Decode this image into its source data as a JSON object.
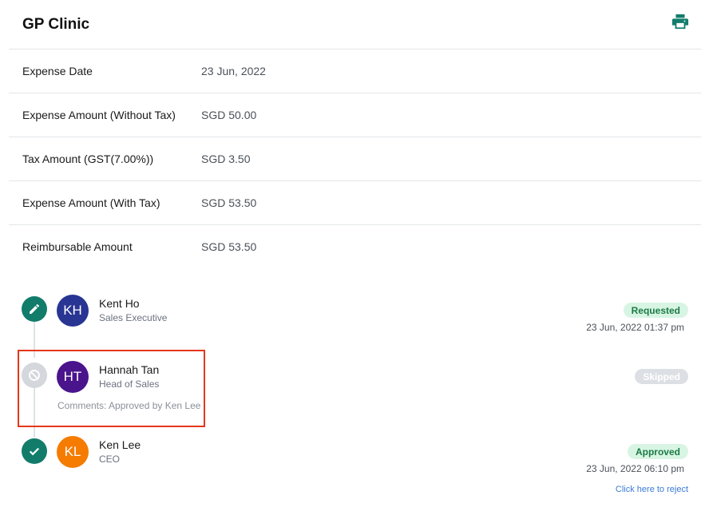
{
  "title": "GP Clinic",
  "print_icon": "printer-icon",
  "details": [
    {
      "label": "Expense Date",
      "value": "23 Jun, 2022"
    },
    {
      "label": "Expense Amount (Without Tax)",
      "value": "SGD 50.00"
    },
    {
      "label": "Tax Amount (GST(7.00%))",
      "value": "SGD 3.50"
    },
    {
      "label": "Expense Amount (With Tax)",
      "value": "SGD 53.50"
    },
    {
      "label": "Reimbursable Amount",
      "value": "SGD 53.50"
    }
  ],
  "approvals": [
    {
      "initials": "KH",
      "name": "Kent Ho",
      "role": "Sales Executive",
      "status": "Requested",
      "timestamp": "23 Jun, 2022 01:37 pm",
      "icon": "pencil-icon",
      "avatar_color": "#283593"
    },
    {
      "initials": "HT",
      "name": "Hannah Tan",
      "role": "Head of Sales",
      "status": "Skipped",
      "comment": "Comments: Approved by Ken Lee",
      "icon": "blocked-icon",
      "avatar_color": "#4a148c"
    },
    {
      "initials": "KL",
      "name": "Ken Lee",
      "role": "CEO",
      "status": "Approved",
      "timestamp": "23 Jun, 2022 06:10 pm",
      "icon": "check-icon",
      "avatar_color": "#f57c00",
      "action": "Click here to reject"
    }
  ],
  "colors": {
    "accent": "#127c6b",
    "highlight": "#e5361a",
    "link": "#3a7bd5"
  }
}
